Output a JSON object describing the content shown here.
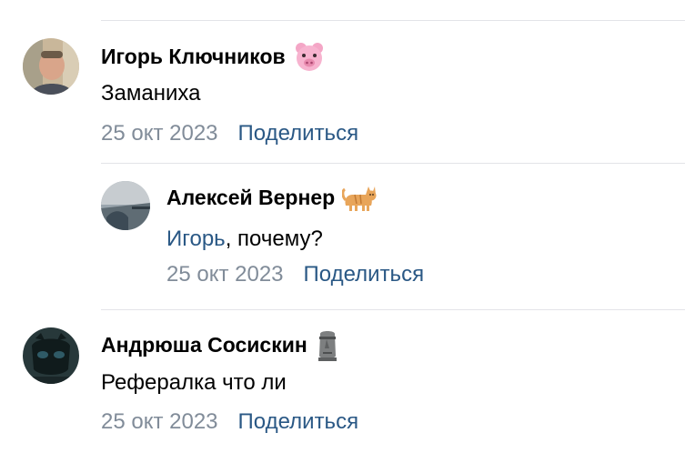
{
  "comments": [
    {
      "author": "Игорь Ключников",
      "author_emoji": "pig-face-icon",
      "text": "Заманиха",
      "date": "25 окт 2023",
      "share_label": "Поделиться"
    },
    {
      "author": "Алексей Вернер",
      "author_emoji": "cat-icon",
      "mention": "Игорь",
      "text": ", почему?",
      "date": "25 окт 2023",
      "share_label": "Поделиться"
    },
    {
      "author": "Андрюша Сосискин",
      "author_emoji": "moai-icon",
      "text": "Рефералка что ли",
      "date": "25 окт 2023",
      "share_label": "Поделиться"
    }
  ],
  "colors": {
    "link": "#2a5885",
    "meta": "#818c99",
    "divider": "#e3e4e8"
  }
}
